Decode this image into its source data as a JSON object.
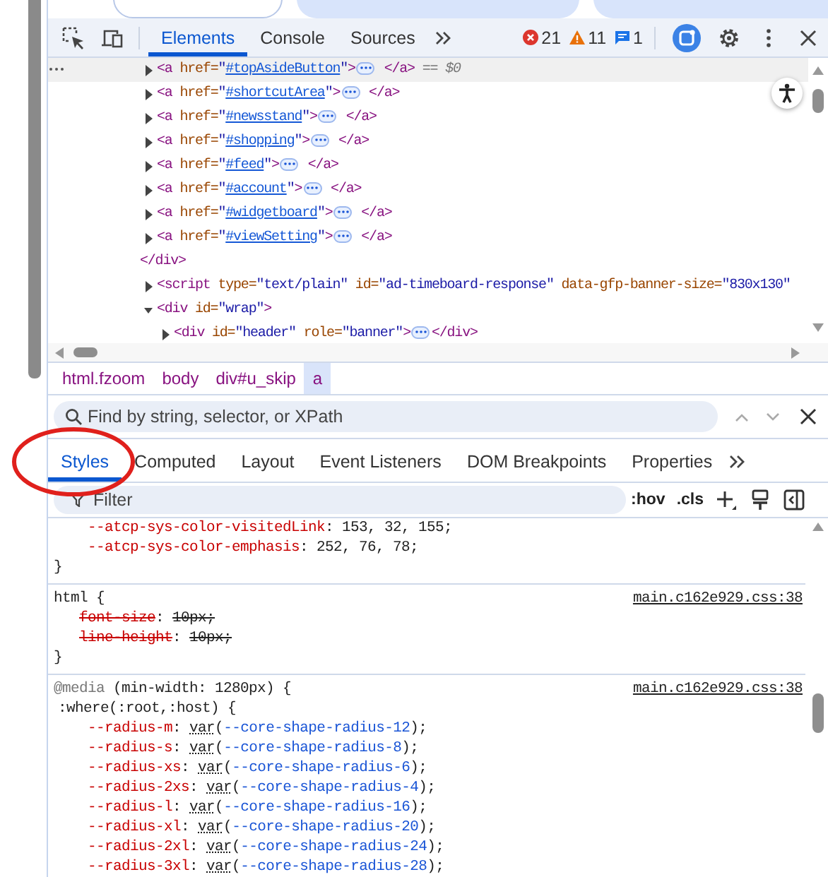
{
  "browser_tabs": [
    {
      "selected": true
    },
    {
      "selected": false
    },
    {
      "selected": false
    }
  ],
  "toolbar": {
    "tabs": [
      {
        "label": "Elements",
        "selected": true
      },
      {
        "label": "Console",
        "selected": false
      },
      {
        "label": "Sources",
        "selected": false
      }
    ],
    "issues": [
      {
        "kind": "error",
        "count": "21"
      },
      {
        "kind": "warning",
        "count": "11"
      },
      {
        "kind": "info",
        "count": "1"
      }
    ]
  },
  "dom_tree": [
    {
      "kind": "hidden-open",
      "closing": [
        {
          "kind": "tag",
          "text": "</div>"
        }
      ],
      "children": [
        {
          "expanded": false,
          "selected": true,
          "tokens": [
            {
              "kind": "tag",
              "text": "<a"
            },
            {
              "kind": "attr",
              "text": " href="
            },
            {
              "kind": "val",
              "text": "\""
            },
            {
              "kind": "link",
              "text": "#topAsideButton"
            },
            {
              "kind": "val",
              "text": "\""
            },
            {
              "kind": "tag",
              "text": ">"
            },
            {
              "kind": "pill"
            },
            {
              "kind": "tag",
              "text": " </a>"
            },
            {
              "kind": "marker",
              "text": " == $0"
            }
          ]
        },
        {
          "expanded": false,
          "selected": false,
          "tokens": [
            {
              "kind": "tag",
              "text": "<a"
            },
            {
              "kind": "attr",
              "text": " href="
            },
            {
              "kind": "val",
              "text": "\""
            },
            {
              "kind": "link",
              "text": "#shortcutArea"
            },
            {
              "kind": "val",
              "text": "\""
            },
            {
              "kind": "tag",
              "text": ">"
            },
            {
              "kind": "pill"
            },
            {
              "kind": "tag",
              "text": " </a>"
            }
          ]
        },
        {
          "expanded": false,
          "selected": false,
          "tokens": [
            {
              "kind": "tag",
              "text": "<a"
            },
            {
              "kind": "attr",
              "text": " href="
            },
            {
              "kind": "val",
              "text": "\""
            },
            {
              "kind": "link",
              "text": "#newsstand"
            },
            {
              "kind": "val",
              "text": "\""
            },
            {
              "kind": "tag",
              "text": ">"
            },
            {
              "kind": "pill"
            },
            {
              "kind": "tag",
              "text": " </a>"
            }
          ]
        },
        {
          "expanded": false,
          "selected": false,
          "tokens": [
            {
              "kind": "tag",
              "text": "<a"
            },
            {
              "kind": "attr",
              "text": " href="
            },
            {
              "kind": "val",
              "text": "\""
            },
            {
              "kind": "link",
              "text": "#shopping"
            },
            {
              "kind": "val",
              "text": "\""
            },
            {
              "kind": "tag",
              "text": ">"
            },
            {
              "kind": "pill"
            },
            {
              "kind": "tag",
              "text": " </a>"
            }
          ]
        },
        {
          "expanded": false,
          "selected": false,
          "tokens": [
            {
              "kind": "tag",
              "text": "<a"
            },
            {
              "kind": "attr",
              "text": " href="
            },
            {
              "kind": "val",
              "text": "\""
            },
            {
              "kind": "link",
              "text": "#feed"
            },
            {
              "kind": "val",
              "text": "\""
            },
            {
              "kind": "tag",
              "text": ">"
            },
            {
              "kind": "pill"
            },
            {
              "kind": "tag",
              "text": " </a>"
            }
          ]
        },
        {
          "expanded": false,
          "selected": false,
          "tokens": [
            {
              "kind": "tag",
              "text": "<a"
            },
            {
              "kind": "attr",
              "text": " href="
            },
            {
              "kind": "val",
              "text": "\""
            },
            {
              "kind": "link",
              "text": "#account"
            },
            {
              "kind": "val",
              "text": "\""
            },
            {
              "kind": "tag",
              "text": ">"
            },
            {
              "kind": "pill"
            },
            {
              "kind": "tag",
              "text": " </a>"
            }
          ]
        },
        {
          "expanded": false,
          "selected": false,
          "tokens": [
            {
              "kind": "tag",
              "text": "<a"
            },
            {
              "kind": "attr",
              "text": " href="
            },
            {
              "kind": "val",
              "text": "\""
            },
            {
              "kind": "link",
              "text": "#widgetboard"
            },
            {
              "kind": "val",
              "text": "\""
            },
            {
              "kind": "tag",
              "text": ">"
            },
            {
              "kind": "pill"
            },
            {
              "kind": "tag",
              "text": " </a>"
            }
          ]
        },
        {
          "expanded": false,
          "selected": false,
          "tokens": [
            {
              "kind": "tag",
              "text": "<a"
            },
            {
              "kind": "attr",
              "text": " href="
            },
            {
              "kind": "val",
              "text": "\""
            },
            {
              "kind": "link",
              "text": "#viewSetting"
            },
            {
              "kind": "val",
              "text": "\""
            },
            {
              "kind": "tag",
              "text": ">"
            },
            {
              "kind": "pill"
            },
            {
              "kind": "tag",
              "text": " </a>"
            }
          ]
        }
      ]
    },
    {
      "expanded": false,
      "selected": false,
      "tokens": [
        {
          "kind": "tag",
          "text": "<script"
        },
        {
          "kind": "attr",
          "text": " type="
        },
        {
          "kind": "val",
          "text": "\"text/plain\""
        },
        {
          "kind": "attr",
          "text": " id="
        },
        {
          "kind": "val",
          "text": "\"ad-timeboard-response\""
        },
        {
          "kind": "attr",
          "text": " data-gfp-banner-size="
        },
        {
          "kind": "val",
          "text": "\"830x130\""
        }
      ]
    },
    {
      "expanded": true,
      "selected": false,
      "tokens": [
        {
          "kind": "tag",
          "text": "<div"
        },
        {
          "kind": "attr",
          "text": " id="
        },
        {
          "kind": "val",
          "text": "\"wrap\""
        },
        {
          "kind": "tag",
          "text": ">"
        }
      ],
      "children": [
        {
          "expanded": false,
          "selected": false,
          "tokens": [
            {
              "kind": "tag",
              "text": "<div"
            },
            {
              "kind": "attr",
              "text": " id="
            },
            {
              "kind": "val",
              "text": "\"header\""
            },
            {
              "kind": "attr",
              "text": " role="
            },
            {
              "kind": "val",
              "text": "\"banner\""
            },
            {
              "kind": "tag",
              "text": ">"
            },
            {
              "kind": "pill"
            },
            {
              "kind": "tag",
              "text": "</div>"
            }
          ]
        }
      ]
    }
  ],
  "breadcrumbs": [
    {
      "label": "html.fzoom",
      "selected": false
    },
    {
      "label": "body",
      "selected": false
    },
    {
      "label": "div#u_skip",
      "selected": false
    },
    {
      "label": "a",
      "selected": true
    }
  ],
  "search": {
    "placeholder": "Find by string, selector, or XPath"
  },
  "sidebar_tabs": [
    {
      "label": "Styles",
      "selected": true
    },
    {
      "label": "Computed",
      "selected": false
    },
    {
      "label": "Layout",
      "selected": false
    },
    {
      "label": "Event Listeners",
      "selected": false
    },
    {
      "label": "DOM Breakpoints",
      "selected": false
    },
    {
      "label": "Properties",
      "selected": false
    }
  ],
  "filter": {
    "placeholder": "Filter",
    "hov": ":hov",
    "cls": ".cls"
  },
  "style_rules": [
    {
      "properties": [
        {
          "name": "--atcp-sys-color-visitedLink",
          "colon": ": ",
          "value": [
            {
              "kind": "plain",
              "text": "153, 32, 155;"
            }
          ],
          "struck": false
        },
        {
          "name": "--atcp-sys-color-emphasis",
          "colon": ": ",
          "value": [
            {
              "kind": "plain",
              "text": "252, 76, 78;"
            }
          ],
          "struck": false
        }
      ],
      "close": "}"
    },
    {
      "selector": "html {",
      "source": "main.c162e929.css:38",
      "properties": [
        {
          "name": "font-size",
          "colon": ": ",
          "value": [
            {
              "kind": "plain",
              "text": "10px;"
            }
          ],
          "struck": true
        },
        {
          "name": "line-height",
          "colon": ": ",
          "value": [
            {
              "kind": "plain",
              "text": "10px;"
            }
          ],
          "struck": true
        }
      ],
      "close": "}"
    },
    {
      "at_rule": "@media",
      "condition": " (min-width: 1280px) {",
      "source": "main.c162e929.css:38",
      "selector": ":where(:root,:host) {",
      "properties": [
        {
          "name": "--radius-m",
          "colon": ": ",
          "value": [
            {
              "kind": "fn",
              "text": "var"
            },
            {
              "kind": "plain",
              "text": "("
            },
            {
              "kind": "ref",
              "text": "--core-shape-radius-12"
            },
            {
              "kind": "plain",
              "text": ");"
            }
          ],
          "struck": false
        },
        {
          "name": "--radius-s",
          "colon": ": ",
          "value": [
            {
              "kind": "fn",
              "text": "var"
            },
            {
              "kind": "plain",
              "text": "("
            },
            {
              "kind": "ref",
              "text": "--core-shape-radius-8"
            },
            {
              "kind": "plain",
              "text": ");"
            }
          ],
          "struck": false
        },
        {
          "name": "--radius-xs",
          "colon": ": ",
          "value": [
            {
              "kind": "fn",
              "text": "var"
            },
            {
              "kind": "plain",
              "text": "("
            },
            {
              "kind": "ref",
              "text": "--core-shape-radius-6"
            },
            {
              "kind": "plain",
              "text": ");"
            }
          ],
          "struck": false
        },
        {
          "name": "--radius-2xs",
          "colon": ": ",
          "value": [
            {
              "kind": "fn",
              "text": "var"
            },
            {
              "kind": "plain",
              "text": "("
            },
            {
              "kind": "ref",
              "text": "--core-shape-radius-4"
            },
            {
              "kind": "plain",
              "text": ");"
            }
          ],
          "struck": false
        },
        {
          "name": "--radius-l",
          "colon": ": ",
          "value": [
            {
              "kind": "fn",
              "text": "var"
            },
            {
              "kind": "plain",
              "text": "("
            },
            {
              "kind": "ref",
              "text": "--core-shape-radius-16"
            },
            {
              "kind": "plain",
              "text": ");"
            }
          ],
          "struck": false
        },
        {
          "name": "--radius-xl",
          "colon": ": ",
          "value": [
            {
              "kind": "fn",
              "text": "var"
            },
            {
              "kind": "plain",
              "text": "("
            },
            {
              "kind": "ref",
              "text": "--core-shape-radius-20"
            },
            {
              "kind": "plain",
              "text": ");"
            }
          ],
          "struck": false
        },
        {
          "name": "--radius-2xl",
          "colon": ": ",
          "value": [
            {
              "kind": "fn",
              "text": "var"
            },
            {
              "kind": "plain",
              "text": "("
            },
            {
              "kind": "ref",
              "text": "--core-shape-radius-24"
            },
            {
              "kind": "plain",
              "text": ");"
            }
          ],
          "struck": false
        },
        {
          "name": "--radius-3xl",
          "colon": ": ",
          "value": [
            {
              "kind": "fn",
              "text": "var"
            },
            {
              "kind": "plain",
              "text": "("
            },
            {
              "kind": "ref",
              "text": "--core-shape-radius-28"
            },
            {
              "kind": "plain",
              "text": ");"
            }
          ],
          "struck": false
        }
      ]
    }
  ]
}
